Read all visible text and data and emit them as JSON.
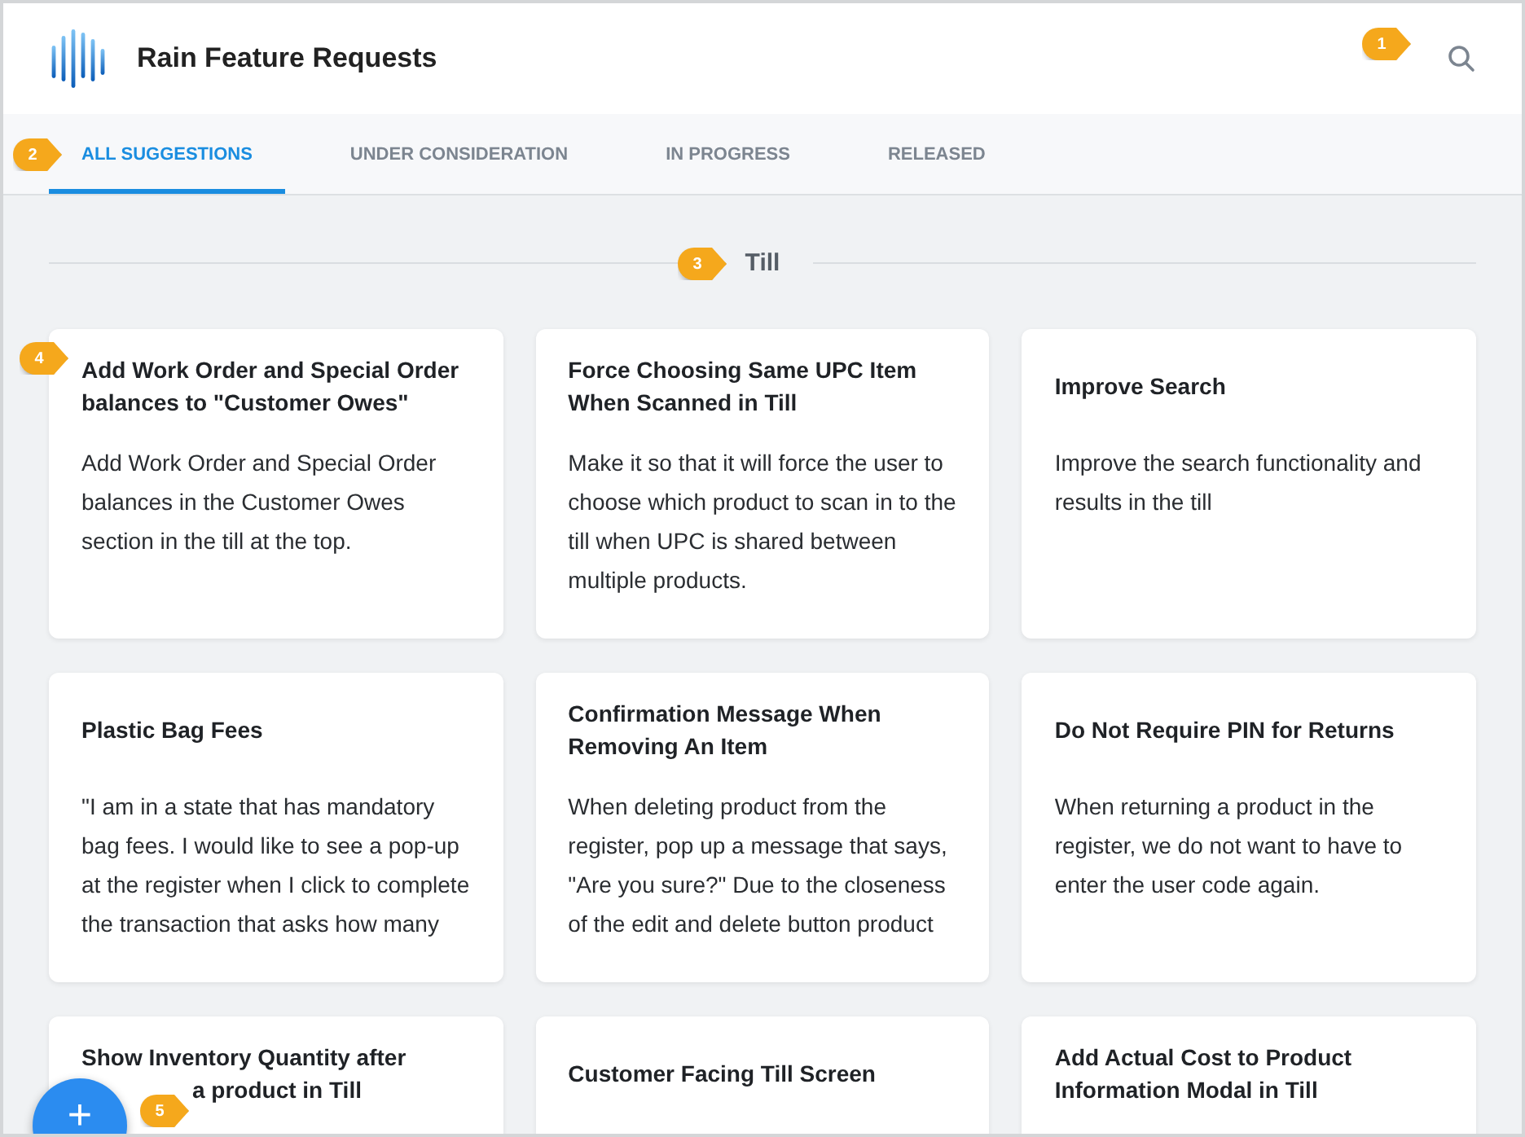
{
  "header": {
    "title": "Rain Feature Requests",
    "search_callout": "1"
  },
  "tabs_callout": "2",
  "tabs": [
    {
      "label": "ALL SUGGESTIONS",
      "selected": true
    },
    {
      "label": "UNDER CONSIDERATION",
      "selected": false
    },
    {
      "label": "IN PROGRESS",
      "selected": false
    },
    {
      "label": "RELEASED",
      "selected": false
    }
  ],
  "section": {
    "title": "Till",
    "callout": "3"
  },
  "cards": [
    {
      "title": "Add Work Order and Special Order balances to \"Customer Owes\"",
      "body": "Add Work Order and Special Order balances in the Customer Owes section in the till at the top.",
      "callout": "4"
    },
    {
      "title": "Force Choosing Same UPC Item When Scanned in Till",
      "body": "Make it so that it will force the user to choose which product to scan in to the till when UPC is shared between multiple products."
    },
    {
      "title": "Improve Search",
      "body": "Improve the search functionality and results in the till"
    },
    {
      "title": "Plastic Bag Fees",
      "body": "\"I am in a state that has mandatory bag fees. I would like to see a pop-up at the register when I click to complete the transaction that asks how many"
    },
    {
      "title": "Confirmation Message When Removing An Item",
      "body": "When deleting product from the register, pop up a message that says, \"Are you sure?\" Due to the closeness of the edit and delete button product"
    },
    {
      "title": "Do Not Require PIN for Returns",
      "body": "When returning a product in the register, we do not want to have to enter the user code again."
    },
    {
      "title": "Show Inventory Quantity after",
      "title_line_2": "a product in Till"
    },
    {
      "title": "Customer Facing Till Screen"
    },
    {
      "title": "Add Actual Cost to Product Information Modal in Till"
    }
  ],
  "fab": {
    "label": "+",
    "callout": "5"
  }
}
